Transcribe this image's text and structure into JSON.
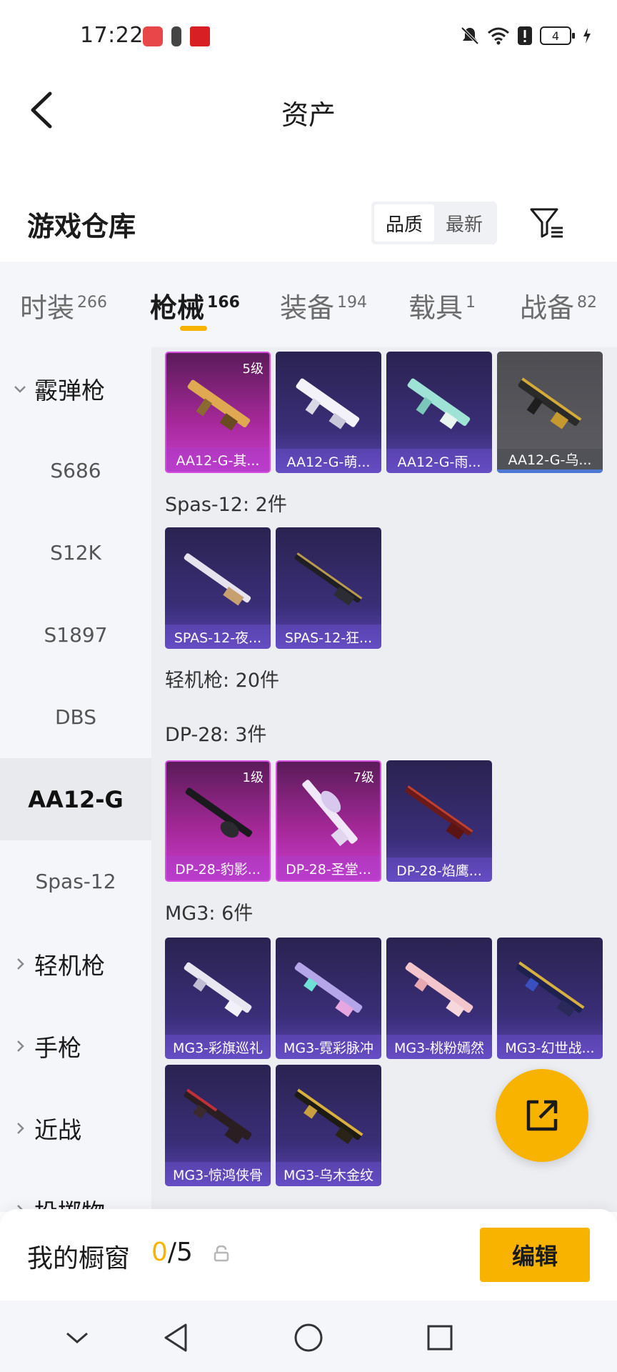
{
  "status_bar": {
    "time": "17:22",
    "battery": "4"
  },
  "header": {
    "title": "资产"
  },
  "warehouse": {
    "title": "游戏仓库",
    "sort_options": [
      "品质",
      "最新"
    ],
    "active_sort": "品质"
  },
  "categories": [
    {
      "label": "时装",
      "count": "266"
    },
    {
      "label": "枪械",
      "count": "166"
    },
    {
      "label": "装备",
      "count": "194"
    },
    {
      "label": "载具",
      "count": "1"
    },
    {
      "label": "战备",
      "count": "82"
    }
  ],
  "sidebar": {
    "items": [
      {
        "label": "霰弹枪",
        "type": "group",
        "expanded": true
      },
      {
        "label": "S686"
      },
      {
        "label": "S12K"
      },
      {
        "label": "S1897"
      },
      {
        "label": "DBS"
      },
      {
        "label": "AA12-G",
        "active": true
      },
      {
        "label": "Spas-12"
      },
      {
        "label": "轻机枪",
        "type": "group"
      },
      {
        "label": "手枪",
        "type": "group"
      },
      {
        "label": "近战",
        "type": "group"
      },
      {
        "label": "投掷物",
        "type": "group"
      }
    ]
  },
  "content": {
    "aa12_items": [
      {
        "name": "AA12-G-其...",
        "level": "5级",
        "rarity": "pink"
      },
      {
        "name": "AA12-G-萌...",
        "rarity": "purple"
      },
      {
        "name": "AA12-G-雨...",
        "rarity": "purple"
      },
      {
        "name": "AA12-G-乌...",
        "rarity": "gray"
      }
    ],
    "spas_title": "Spas-12: 2件",
    "spas_items": [
      {
        "name": "SPAS-12-夜...",
        "rarity": "purple"
      },
      {
        "name": "SPAS-12-狂...",
        "rarity": "purple"
      }
    ],
    "lmg_title": "轻机枪: 20件",
    "dp28_title": "DP-28: 3件",
    "dp28_items": [
      {
        "name": "DP-28-豹影...",
        "level": "1级",
        "rarity": "pink"
      },
      {
        "name": "DP-28-圣堂...",
        "level": "7级",
        "rarity": "pink"
      },
      {
        "name": "DP-28-焰鹰...",
        "rarity": "purple"
      }
    ],
    "mg3_title": "MG3: 6件",
    "mg3_items": [
      {
        "name": "MG3-彩旗巡礼",
        "rarity": "purple"
      },
      {
        "name": "MG3-霓彩脉冲",
        "rarity": "purple"
      },
      {
        "name": "MG3-桃粉嫣然",
        "rarity": "purple"
      },
      {
        "name": "MG3-幻世战...",
        "rarity": "purple"
      },
      {
        "name": "MG3-惊鸿侠骨",
        "rarity": "purple"
      },
      {
        "name": "MG3-乌木金纹",
        "rarity": "purple"
      }
    ]
  },
  "showcase": {
    "label": "我的橱窗",
    "current": "0",
    "total": "/5",
    "edit_label": "编辑"
  },
  "icons": {
    "back": "back-arrow-icon",
    "filter": "filter-icon",
    "fab": "share-external-icon",
    "lock": "lock-icon"
  },
  "colors": {
    "accent": "#f7b300",
    "card_purple": "#3a2e78",
    "card_pink": "#a8299c"
  }
}
